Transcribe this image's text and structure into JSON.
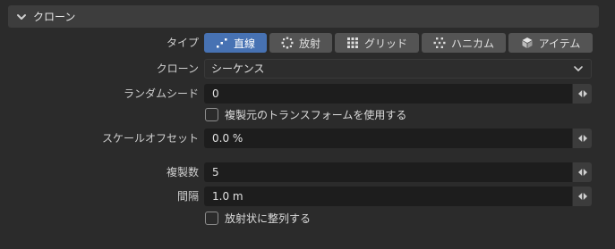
{
  "panel": {
    "title": "クローン",
    "expanded": true
  },
  "type_row": {
    "label": "タイプ",
    "options": [
      {
        "label": "直線",
        "icon": "line-icon",
        "active": true
      },
      {
        "label": "放射",
        "icon": "radial-icon",
        "active": false
      },
      {
        "label": "グリッド",
        "icon": "grid-icon",
        "active": false
      },
      {
        "label": "ハニカム",
        "icon": "honeycomb-icon",
        "active": false
      },
      {
        "label": "アイテム",
        "icon": "cube-icon",
        "active": false
      }
    ]
  },
  "clone_row": {
    "label": "クローン",
    "value": "シーケンス"
  },
  "random_seed": {
    "label": "ランダムシード",
    "value": "0"
  },
  "copy_transform": {
    "label": "複製元のトランスフォームを使用する",
    "checked": false
  },
  "scale_offset": {
    "label": "スケールオフセット",
    "value": "0.0 %"
  },
  "count": {
    "label": "複製数",
    "value": "5"
  },
  "spacing": {
    "label": "間隔",
    "value": "1.0 m"
  },
  "radial_align": {
    "label": "放射状に整列する",
    "checked": false
  },
  "colors": {
    "accent": "#4772b3",
    "background": "#2b2b2b",
    "field": "#1d1d1d"
  }
}
